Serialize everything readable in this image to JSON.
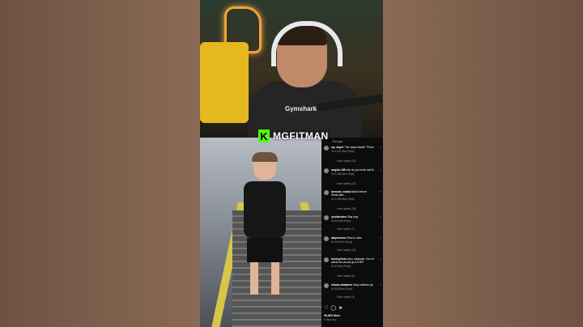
{
  "streamer_tag": {
    "name": "MGFITMAN",
    "logo_letter": "K"
  },
  "shirt_text": "Gymshark",
  "comments_panel": {
    "header": "For you",
    "comments": [
      {
        "user": "sjo_dopid",
        "text": "\"Two steps ahead\" \"Proce",
        "time": "2d",
        "likes": "4,602 likes",
        "reply": "Reply",
        "view": "View replies (22)"
      },
      {
        "user": "mayulu.168",
        "text": "why do you never add th",
        "time": "3d",
        "likes": "2,668 likes",
        "reply": "Reply",
        "view": "View replies (42)"
      },
      {
        "user": "brennan_maltok",
        "text": "World before",
        "text2": "World after...",
        "time": "4d",
        "likes": "1,008 likes",
        "reply": "Reply",
        "view": "View replies (35)"
      },
      {
        "user": "rjsiddensten",
        "text": "Stay long",
        "time": "5d",
        "likes": "55 likes",
        "reply": "Reply",
        "view": "View replies (1)"
      },
      {
        "user": "alaynaneese",
        "text": "Real or cake",
        "time": "5d",
        "likes": "340 likes",
        "reply": "Reply",
        "view": "View replies (22)"
      },
      {
        "user": "bood.grimes",
        "text": "Aww, rakasado. Our rel",
        "text2": "ahead we should go a STEP",
        "time": "5d",
        "likes": "52 likes",
        "reply": "Reply",
        "view": "View replies (8)"
      },
      {
        "user": "mboza.sbbaahun",
        "text": "Okay shirtless pic",
        "time": "5d",
        "likes": "334 likes",
        "reply": "Reply",
        "view": "View replies (3)"
      }
    ],
    "total_likes": "30,803 likes",
    "posted": "5 days ago"
  },
  "colors": {
    "kick_green": "#53fc18",
    "panel_bg": "#0c0c0c",
    "side_bg": "#7a5a48"
  }
}
